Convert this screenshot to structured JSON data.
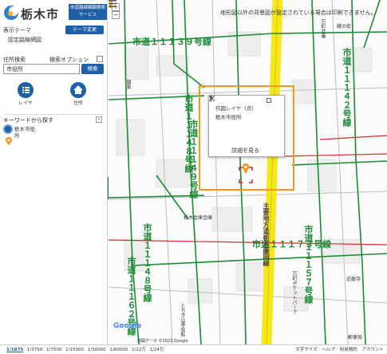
{
  "app": {
    "city_name": "栃木市",
    "service_badge": "市道路線網図検索サービス"
  },
  "sidebar": {
    "theme_section_label": "表示テーマ",
    "theme_change_button": "テーマ変更",
    "current_theme": "認定路線網図",
    "address_search_label": "住所検索",
    "search_option_label": "検索オプション",
    "address_input_value": "市役所",
    "search_button": "検索",
    "layer_button_label": "レイヤ",
    "address_button_label": "住所",
    "keyword_search_label": "キーワードから探す",
    "keyword_collapse": "v",
    "result_label_line1": "栃木市役",
    "result_label_line2": "所"
  },
  "map": {
    "notice": "地形図以外の背景図が設定されている場合は印刷できません。",
    "zoom_in": "+",
    "zoom_out": "−",
    "popup": {
      "title": "作図レイヤ（点）",
      "body": "栃木市役所",
      "detail_button": "詳細を見る"
    },
    "route_labels": [
      {
        "text": "市道１１１３９号線",
        "orient": "h"
      },
      {
        "text": "市道１１１４８号線",
        "orient": "v"
      },
      {
        "text": "市道１１１４９号線",
        "orient": "v"
      },
      {
        "text": "市道１１１４２号線",
        "orient": "v"
      },
      {
        "text": "市道１１１７３号線",
        "orient": "h"
      },
      {
        "text": "市道１１１５７号線",
        "orient": "v"
      },
      {
        "text": "市道１１１６２号線",
        "orient": "v"
      },
      {
        "text": "市道１１１４８号線",
        "orient": "v"
      },
      {
        "text": "主要地方道栃木藤岡線",
        "orient": "v"
      }
    ],
    "place_labels": [
      "栃木倉庫金庫",
      "とちぎ山車会館",
      "万町ポケットパーク",
      "近龍寺",
      "万町交番",
      "蔵の街",
      "関東",
      "郵便局"
    ],
    "google_logo": "Google",
    "footnote": "地図データ ©2023 Google"
  },
  "footer": {
    "scales": [
      "1/1875",
      "1/3750",
      "1/7500",
      "1/15000",
      "1/30000",
      "1/60000",
      "1/12万",
      "1/24万"
    ],
    "active_scale": "1/1875",
    "links": [
      "文字サイズ",
      "ヘルプ",
      "利用規約",
      "アカウント"
    ]
  },
  "colors": {
    "accent": "#1f5fa8",
    "route_green": "#1a8a34",
    "highlight_orange": "#f19a1d",
    "main_road_yellow": "#f5e71a",
    "red_line": "#d92b2b"
  }
}
